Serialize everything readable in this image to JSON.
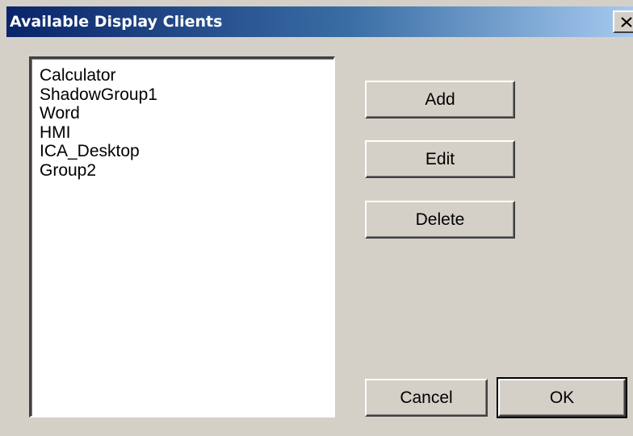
{
  "window": {
    "title": "Available Display Clients",
    "close_icon": "close-icon"
  },
  "client_list": {
    "items": [
      {
        "label": "Calculator"
      },
      {
        "label": "ShadowGroup1"
      },
      {
        "label": "Word"
      },
      {
        "label": "HMI"
      },
      {
        "label": "ICA_Desktop"
      },
      {
        "label": "Group2"
      }
    ]
  },
  "buttons": {
    "add": "Add",
    "edit": "Edit",
    "delete": "Delete",
    "cancel": "Cancel",
    "ok": "OK"
  },
  "colors": {
    "title_gradient_start": "#0a246a",
    "title_gradient_end": "#a6caf0",
    "dialog_background": "#d4d0c8",
    "list_background": "#ffffff"
  }
}
